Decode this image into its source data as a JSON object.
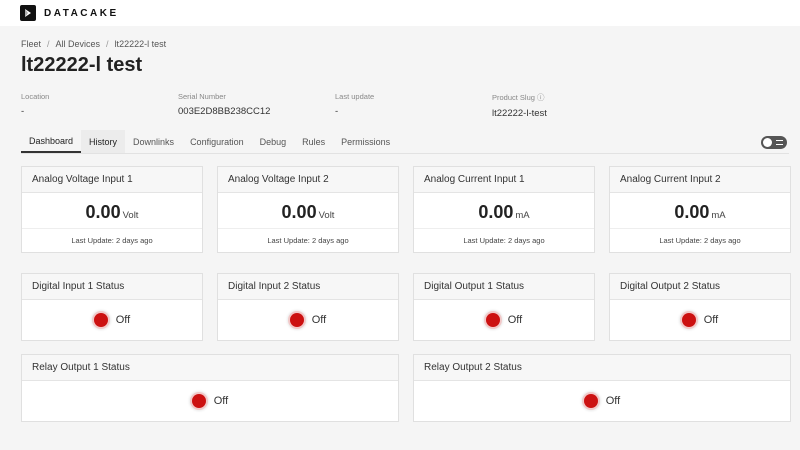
{
  "app": {
    "logo_text": "DATACAKE"
  },
  "breadcrumb": [
    "Fleet",
    "All Devices",
    "lt22222-l test"
  ],
  "page_title": "lt22222-l test",
  "meta": [
    {
      "label": "Location",
      "value": "-"
    },
    {
      "label": "Serial Number",
      "value": "003E2D8BB238CC12"
    },
    {
      "label": "Last update",
      "value": "-"
    },
    {
      "label": "Product Slug ⓘ",
      "value": "lt22222-l-test"
    }
  ],
  "tabs": [
    {
      "label": "Dashboard"
    },
    {
      "label": "History"
    },
    {
      "label": "Downlinks"
    },
    {
      "label": "Configuration"
    },
    {
      "label": "Debug"
    },
    {
      "label": "Rules"
    },
    {
      "label": "Permissions"
    }
  ],
  "value_widgets": [
    {
      "title": "Analog Voltage Input 1",
      "value": "0.00",
      "unit": "Volt",
      "footer": "Last Update: 2 days ago"
    },
    {
      "title": "Analog Voltage Input 2",
      "value": "0.00",
      "unit": "Volt",
      "footer": "Last Update: 2 days ago"
    },
    {
      "title": "Analog Current Input 1",
      "value": "0.00",
      "unit": "mA",
      "footer": "Last Update: 2 days ago"
    },
    {
      "title": "Analog Current Input 2",
      "value": "0.00",
      "unit": "mA",
      "footer": "Last Update: 2 days ago"
    }
  ],
  "status_widgets": [
    {
      "title": "Digital Input 1 Status",
      "state": "Off"
    },
    {
      "title": "Digital Input 2 Status",
      "state": "Off"
    },
    {
      "title": "Digital Output 1 Status",
      "state": "Off"
    },
    {
      "title": "Digital Output 2 Status",
      "state": "Off"
    }
  ],
  "relay_widgets": [
    {
      "title": "Relay Output 1 Status",
      "state": "Off"
    },
    {
      "title": "Relay Output 2 Status",
      "state": "Off"
    }
  ],
  "colors": {
    "status_off": "#cc1111",
    "accent": "#111111"
  },
  "icons": {
    "logo": "datacake-logo-icon",
    "toggle": "edit-mode-toggle-icon"
  }
}
